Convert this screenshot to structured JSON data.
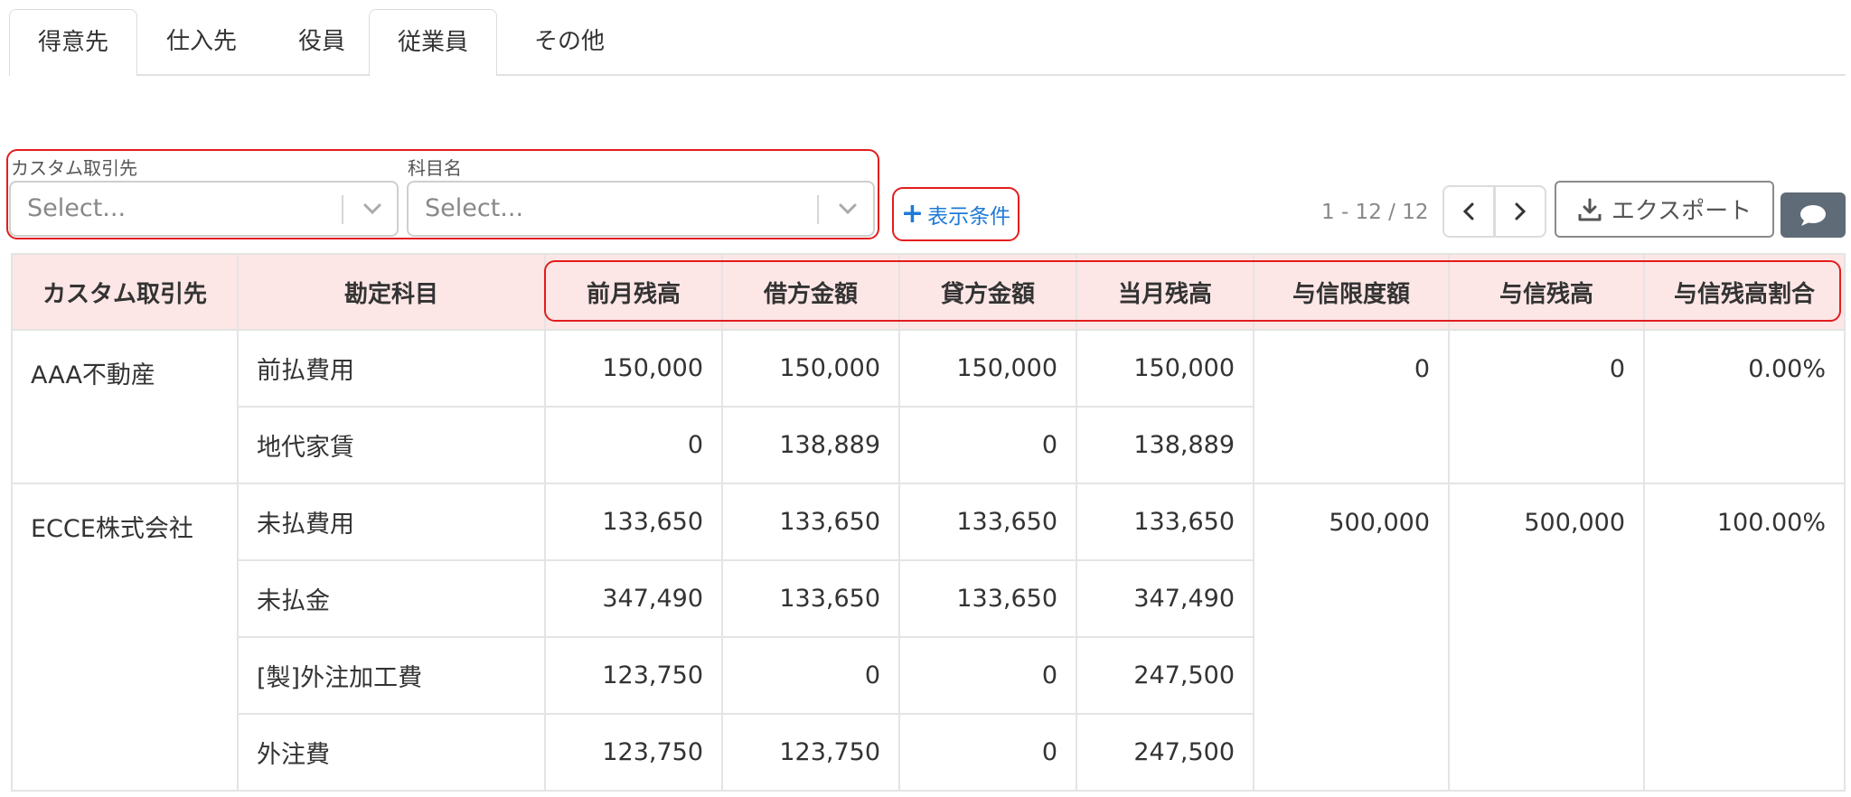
{
  "tabs": [
    "得意先",
    "仕入先",
    "役員",
    "従業員",
    "その他"
  ],
  "filters": {
    "partner_label": "カスタム取引先",
    "partner_placeholder": "Select...",
    "account_label": "科目名",
    "account_placeholder": "Select..."
  },
  "display_conditions_label": "表示条件",
  "pagination": {
    "range_text": "1 - 12 / 12"
  },
  "export_label": "エクスポート",
  "colors": {
    "highlight_border": "#e21d1d",
    "header_bg": "#fde6e6",
    "link_blue": "#1e7ad6",
    "chat_btn_bg": "#5f6b76"
  },
  "table": {
    "headers": [
      "カスタム取引先",
      "勘定科目",
      "前月残高",
      "借方金額",
      "貸方金額",
      "当月残高",
      "与信限度額",
      "与信残高",
      "与信残高割合"
    ],
    "groups": [
      {
        "partner": "AAA不動産",
        "credit_limit": "0",
        "credit_balance": "0",
        "credit_ratio": "0.00%",
        "rows": [
          {
            "account": "前払費用",
            "prev": "150,000",
            "debit": "150,000",
            "credit": "150,000",
            "current": "150,000"
          },
          {
            "account": "地代家賃",
            "prev": "0",
            "debit": "138,889",
            "credit": "0",
            "current": "138,889"
          }
        ]
      },
      {
        "partner": "ECCE株式会社",
        "credit_limit": "500,000",
        "credit_balance": "500,000",
        "credit_ratio": "100.00%",
        "rows": [
          {
            "account": "未払費用",
            "prev": "133,650",
            "debit": "133,650",
            "credit": "133,650",
            "current": "133,650"
          },
          {
            "account": "未払金",
            "prev": "347,490",
            "debit": "133,650",
            "credit": "133,650",
            "current": "347,490"
          },
          {
            "account": "[製]外注加工費",
            "prev": "123,750",
            "debit": "0",
            "credit": "0",
            "current": "247,500"
          },
          {
            "account": "外注費",
            "prev": "123,750",
            "debit": "123,750",
            "credit": "0",
            "current": "247,500"
          }
        ]
      }
    ]
  }
}
